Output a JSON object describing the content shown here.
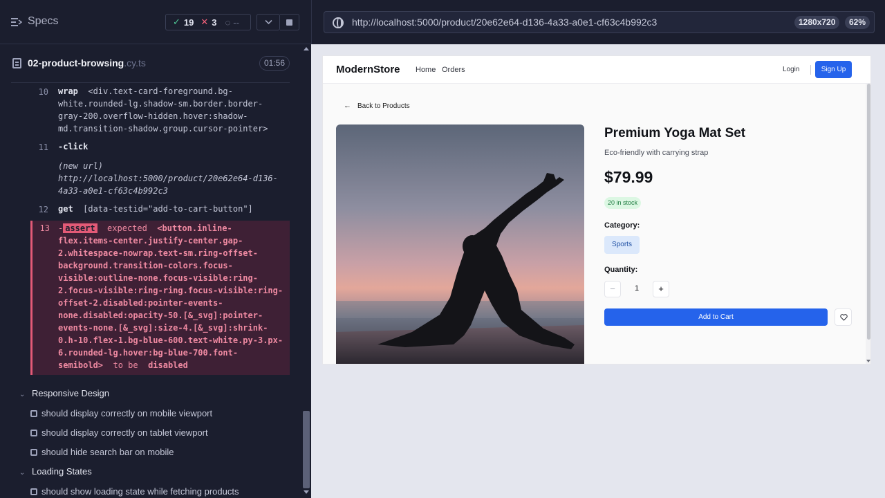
{
  "runner": {
    "header": {
      "title": "Specs",
      "passed": "19",
      "failed": "3",
      "pending": "--"
    },
    "spec": {
      "file_name": "02-product-browsing",
      "file_ext": ".cy.ts",
      "duration": "01:56"
    },
    "commands": [
      {
        "num": "10",
        "name": "wrap",
        "message": "<div.text-card-foreground.bg-white.rounded-lg.shadow-sm.border.border-gray-200.overflow-hidden.hover:shadow-md.transition-shadow.group.cursor-pointer>"
      },
      {
        "num": "11",
        "name": "-click",
        "message": ""
      },
      {
        "num": "",
        "name": "(new url)",
        "message": "http://localhost:5000/product/20e62e64-d136-4a33-a0e1-cf63c4b992c3"
      },
      {
        "num": "12",
        "name": "get",
        "message": "[data-testid=\"add-to-cart-button\"]"
      },
      {
        "num": "13",
        "name": "assert",
        "prefix": "-",
        "expected": "expected",
        "message": "<button.inline-flex.items-center.justify-center.gap-2.whitespace-nowrap.text-sm.ring-offset-background.transition-colors.focus-visible:outline-none.focus-visible:ring-2.focus-visible:ring-ring.focus-visible:ring-offset-2.disabled:pointer-events-none.disabled:opacity-50.[&_svg]:pointer-events-none.[&_svg]:size-4.[&_svg]:shrink-0.h-10.flex-1.bg-blue-600.text-white.py-3.px-6.rounded-lg.hover:bg-blue-700.font-semibold>",
        "to_be": "to be",
        "state": "disabled"
      }
    ],
    "suites": [
      {
        "title": "Responsive Design",
        "tests": [
          "should display correctly on mobile viewport",
          "should display correctly on tablet viewport",
          "should hide search bar on mobile"
        ]
      },
      {
        "title": "Loading States",
        "tests": [
          "should show loading state while fetching products"
        ]
      }
    ]
  },
  "browser": {
    "url": "http://localhost:5000/product/20e62e64-d136-4a33-a0e1-cf63c4b992c3",
    "viewport": "1280x720",
    "zoom": "62%"
  },
  "app": {
    "brand": "ModernStore",
    "nav": {
      "home": "Home",
      "orders": "Orders",
      "login": "Login",
      "signup": "Sign Up"
    },
    "back_link": "Back to Products",
    "product": {
      "title": "Premium Yoga Mat Set",
      "subtitle": "Eco-friendly with carrying strap",
      "price": "$79.99",
      "stock": "20 in stock",
      "category_label": "Category:",
      "category": "Sports",
      "quantity_label": "Quantity:",
      "quantity": "1",
      "add_to_cart": "Add to Cart"
    }
  },
  "icons": {
    "specs": "list-icon",
    "pass": "check-icon",
    "fail": "x-icon",
    "pending": "spinner-icon",
    "file": "file-icon",
    "url": "globe-icon",
    "wishlist": "heart-icon",
    "back": "arrow-left-icon"
  },
  "colors": {
    "runner_bg": "#1b1e2e",
    "fail_accent": "#e35a77",
    "pass_accent": "#4ec795",
    "primary_button": "#2563eb"
  }
}
